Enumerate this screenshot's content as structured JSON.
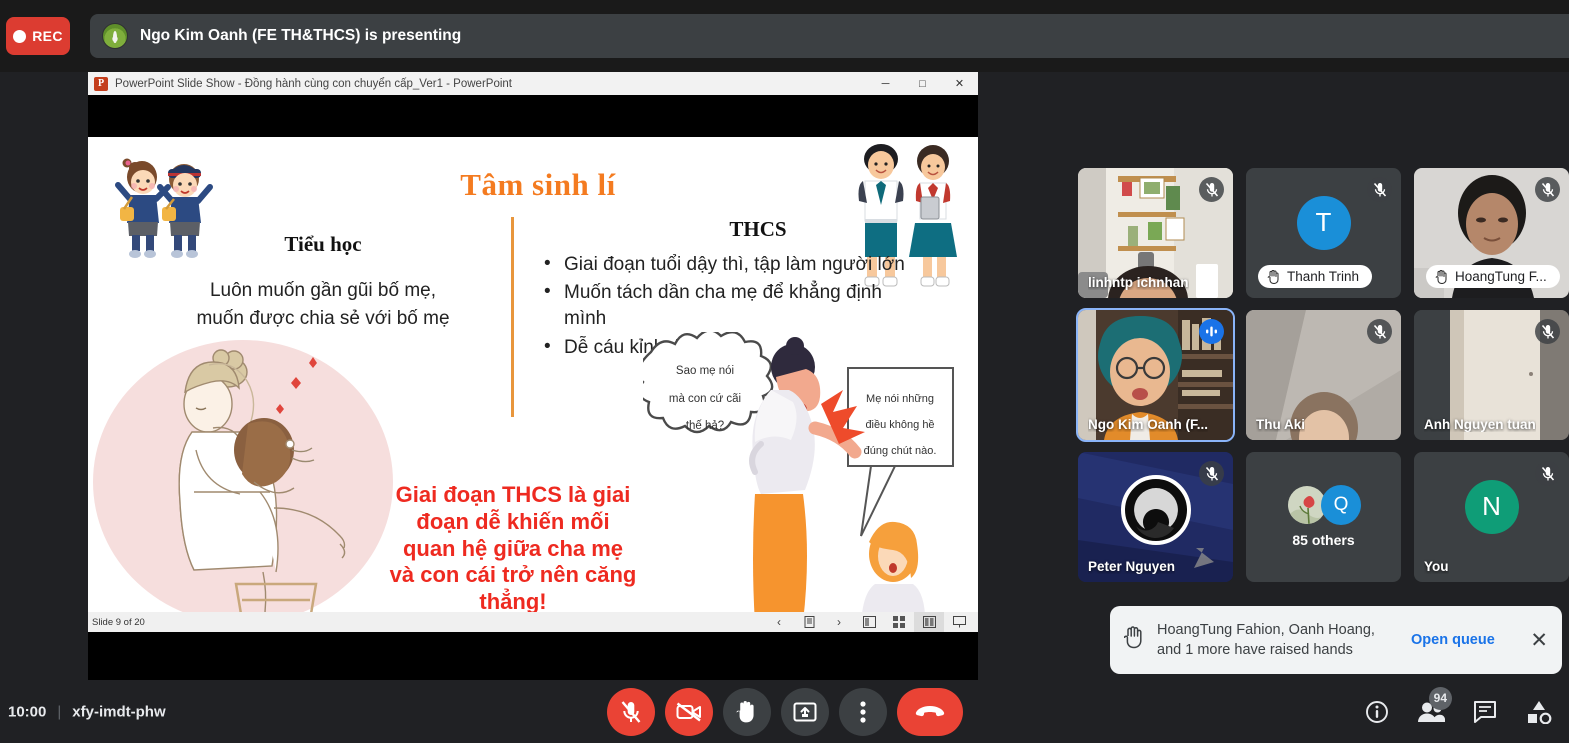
{
  "topbar": {
    "rec_label": "REC",
    "presenting_text": "Ngo Kim Oanh (FE TH&THCS) is presenting"
  },
  "powerpoint": {
    "window_title": "PowerPoint Slide Show  -  Đồng hành cùng con chuyển cấp_Ver1 - PowerPoint",
    "logo_letter": "P",
    "minimize": "─",
    "maximize": "□",
    "close": "✕",
    "status": "Slide 9 of 20",
    "nav_prev": "‹",
    "nav_next": "›",
    "slide": {
      "title": "Tâm sinh lí",
      "left_heading": "Tiểu học",
      "left_text": "Luôn muốn gần gũi bố mẹ,\nmuốn được chia sẻ với bố mẹ",
      "right_heading": "THCS",
      "bullets": [
        "Giai đoạn tuổi dậy thì, tập làm người lớn",
        "Muốn tách dần cha mẹ để khẳng định mình",
        "Dễ cáu kỉnh, khó bảo,..."
      ],
      "red_callout": "Giai đoạn THCS là giai đoạn dễ khiến mối quan hệ giữa cha mẹ và con cái trở nên căng thẳng!",
      "bubble_mother": "Sao mẹ nói mà con cứ cãi thế hả?",
      "bubble_child": "Mẹ nói những điều không hề đúng chút nào."
    }
  },
  "participants": [
    {
      "name": "linhntp ichnhan",
      "muted": true,
      "hand": false,
      "active": false,
      "style": "photo-bookshelf",
      "name_style": "plain"
    },
    {
      "name": "Thanh Trinh",
      "muted": true,
      "hand": true,
      "active": false,
      "style": "avatar",
      "avatar_letter": "T",
      "avatar_color": "#1a8fd8",
      "name_style": "pill"
    },
    {
      "name": "HoangTung F...",
      "muted": true,
      "hand": true,
      "active": false,
      "style": "photo-man",
      "name_style": "pill"
    },
    {
      "name": "Ngo Kim Oanh (F...",
      "muted": false,
      "speaking": true,
      "hand": false,
      "active": true,
      "style": "photo-woman",
      "name_style": "plain"
    },
    {
      "name": "Thu Aki",
      "muted": true,
      "hand": false,
      "active": false,
      "style": "photo-ceiling",
      "name_style": "plain"
    },
    {
      "name": "Anh Nguyen tuan",
      "muted": true,
      "hand": false,
      "active": false,
      "style": "photo-wall",
      "name_style": "plain"
    },
    {
      "name": "Peter Nguyen",
      "muted": true,
      "hand": false,
      "active": false,
      "style": "obs-logo",
      "name_style": "plain"
    },
    {
      "name": "85 others",
      "muted": false,
      "hand": false,
      "active": false,
      "style": "others",
      "avatar_letter": "Q",
      "avatar_color": "#1a8fd8",
      "name_style": "center"
    },
    {
      "name": "You",
      "muted": true,
      "hand": false,
      "active": false,
      "style": "avatar",
      "avatar_letter": "N",
      "avatar_color": "#0f9d77",
      "name_style": "plain"
    }
  ],
  "toast": {
    "message": "HoangTung Fahion, Oanh Hoang, and 1 more have raised hands",
    "action_label": "Open queue",
    "close_label": "✕"
  },
  "bottombar": {
    "time": "10:00",
    "separator": "|",
    "meeting_code": "xfy-imdt-phw",
    "participant_count": "94",
    "controls": [
      {
        "name": "microphone-off-button",
        "state": "danger"
      },
      {
        "name": "camera-off-button",
        "state": "danger"
      },
      {
        "name": "raise-hand-button",
        "state": "normal"
      },
      {
        "name": "present-screen-button",
        "state": "normal"
      },
      {
        "name": "more-options-button",
        "state": "normal"
      },
      {
        "name": "end-call-button",
        "state": "hangup"
      }
    ]
  },
  "colors": {
    "accent_blue": "#1a73e8",
    "danger_red": "#ea4335",
    "rec_red": "#dc3c31",
    "slide_title_orange": "#F47B20",
    "callout_red": "#ee2a20",
    "active_border": "#8ab4f8"
  }
}
